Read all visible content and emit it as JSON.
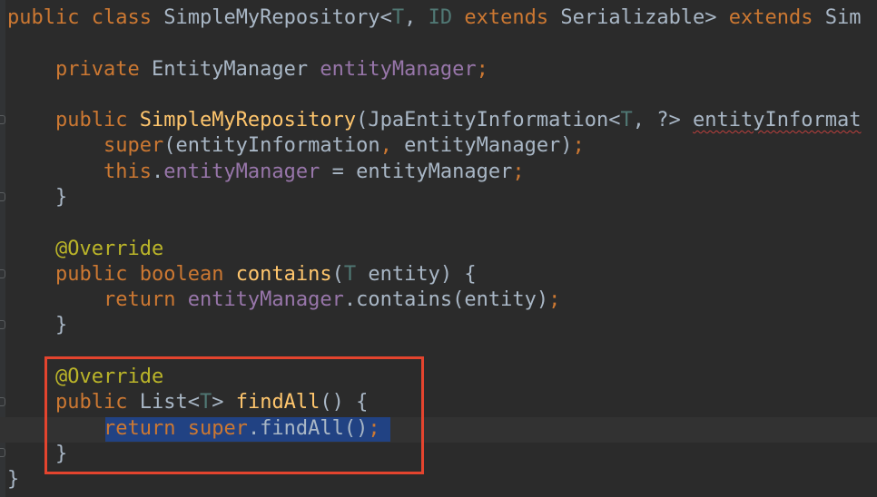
{
  "code": {
    "l1": {
      "public": "public",
      "class": "class",
      "name": "SimpleMyRepository",
      "lt": "<",
      "T": "T",
      "comma": ", ",
      "ID": "ID",
      "extends1": "extends",
      "serializable": "Serializable>",
      "extends2": "extends",
      "cut": "Sim"
    },
    "l2": {
      "private": "private",
      "type": "EntityManager",
      "field": "entityManager",
      "semi": ";"
    },
    "l3": {
      "public": "public",
      "ctor": "SimpleMyRepository",
      "open": "(JpaEntityInformation<",
      "T": "T",
      "rest": ", ?> ",
      "param": "entityInformat"
    },
    "l4": {
      "super": "super",
      "open": "(entityInformation",
      "comma": ",",
      "arg": " entityManager)",
      "semi": ";"
    },
    "l5": {
      "this": "this",
      "dot": ".",
      "field": "entityManager",
      "assign": " = entityManager",
      "semi": ";"
    },
    "l6": {
      "brace": "}"
    },
    "l7": {
      "annotation": "@Override"
    },
    "l8": {
      "public": "public",
      "boolean": "boolean",
      "method": "contains",
      "open": "(",
      "T": "T",
      "rest": " entity) {"
    },
    "l9": {
      "return": "return",
      "field": "entityManager",
      "call": ".contains(entity)",
      "semi": ";"
    },
    "l10": {
      "brace": "}"
    },
    "l11": {
      "annotation": "@Override"
    },
    "l12": {
      "public": "public",
      "list": "List<",
      "T": "T",
      "gt": "> ",
      "method": "findAll",
      "rest": "() {"
    },
    "l13": {
      "return": "return",
      "super": "super",
      "call": ".findAll()",
      "semi": ";"
    },
    "l14": {
      "brace": "}"
    },
    "l15": {
      "brace": "}"
    }
  },
  "colors": {
    "background": "#2b2b2b",
    "keyword": "#cc7832",
    "field": "#9876aa",
    "annotation": "#bbb529",
    "type_param": "#507874",
    "method": "#ffc66d",
    "plain": "#a9b7c6",
    "selection": "#214283",
    "highlight_box": "#e4442e"
  },
  "icons": {
    "fold_markers": "fold-marker-icon"
  }
}
